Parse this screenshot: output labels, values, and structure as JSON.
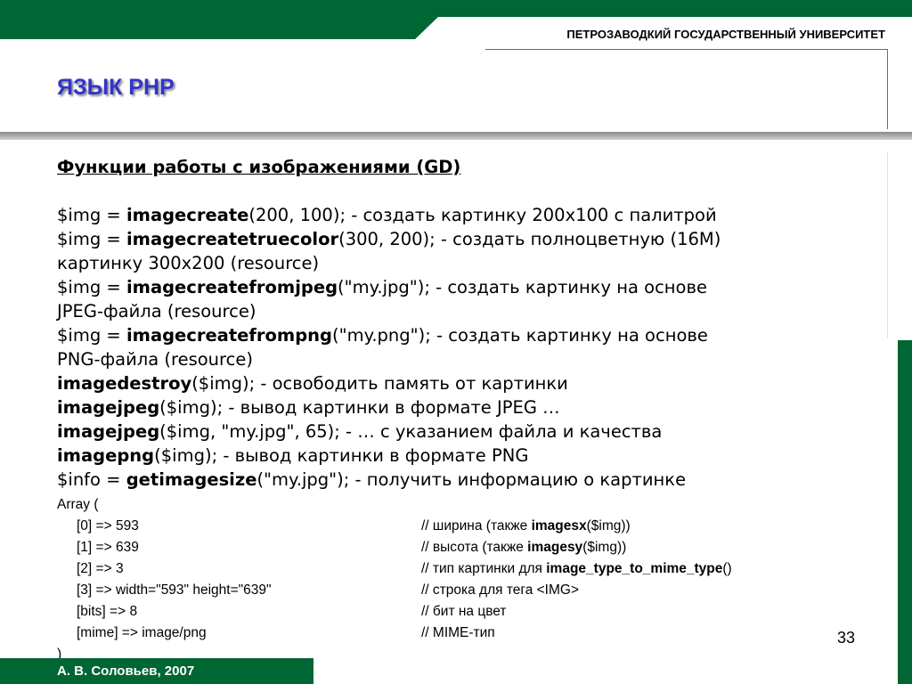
{
  "header": {
    "university": "ПЕТРОЗАВОДКИЙ ГОСУДАРСТВЕННЫЙ УНИВЕРСИТЕТ",
    "title": "ЯЗЫК PHP"
  },
  "content": {
    "heading": "Функции работы с изображениями (GD)",
    "lines": [
      {
        "pre": "$img = ",
        "fn": "imagecreate",
        "post": "(200, 100); - создать картинку 200x100 с палитрой"
      },
      {
        "pre": "$img = ",
        "fn": "imagecreatetruecolor",
        "post": "(300, 200); - создать полноцветную (16M)"
      },
      {
        "pre": "картинку 300x200 (resource)",
        "fn": "",
        "post": ""
      },
      {
        "pre": "$img = ",
        "fn": "imagecreatefromjpeg",
        "post": "(\"my.jpg\"); - создать картинку на основе"
      },
      {
        "pre": "JPEG-файла (resource)",
        "fn": "",
        "post": ""
      },
      {
        "pre": "$img = ",
        "fn": "imagecreatefrompng",
        "post": "(\"my.png\"); - создать картинку на основе"
      },
      {
        "pre": "PNG-файла (resource)",
        "fn": "",
        "post": ""
      },
      {
        "pre": "",
        "fn": "imagedestroy",
        "post": "($img); - освободить память от картинки"
      },
      {
        "pre": "",
        "fn": "imagejpeg",
        "post": "($img); - вывод картинки в формате JPEG …"
      },
      {
        "pre": "",
        "fn": "imagejpeg",
        "post": "($img, \"my.jpg\", 65); - … с указанием файла и качества"
      },
      {
        "pre": "",
        "fn": "imagepng",
        "post": "($img); - вывод картинки в формате PNG"
      },
      {
        "pre": "$info = ",
        "fn": "getimagesize",
        "post": "(\"my.jpg\"); - получить информацию о картинке"
      }
    ]
  },
  "array": {
    "open": "Array (",
    "close": ")",
    "rows": [
      {
        "key": "[0] => 593",
        "c_pre": "// ширина (также ",
        "c_fn": "imagesx",
        "c_post": "($img))"
      },
      {
        "key": "[1] => 639",
        "c_pre": "// высота (также ",
        "c_fn": "imagesy",
        "c_post": "($img))"
      },
      {
        "key": "[2] => 3",
        "c_pre": "// тип картинки для ",
        "c_fn": "image_type_to_mime_type",
        "c_post": "()"
      },
      {
        "key": "[3] => width=\"593\" height=\"639\"",
        "c_pre": "// строка для тега <IMG>",
        "c_fn": "",
        "c_post": ""
      },
      {
        "key": "[bits] => 8",
        "c_pre": "// бит на цвет",
        "c_fn": "",
        "c_post": ""
      },
      {
        "key": "[mime] => image/png",
        "c_pre": "// MIME-тип",
        "c_fn": "",
        "c_post": ""
      }
    ]
  },
  "footer": {
    "author": "А. В. Соловьев, 2007",
    "page": "33"
  },
  "colors": {
    "brand_green": "#006633",
    "title_blue": "#3333cc",
    "accent_red": "#cc4444"
  }
}
